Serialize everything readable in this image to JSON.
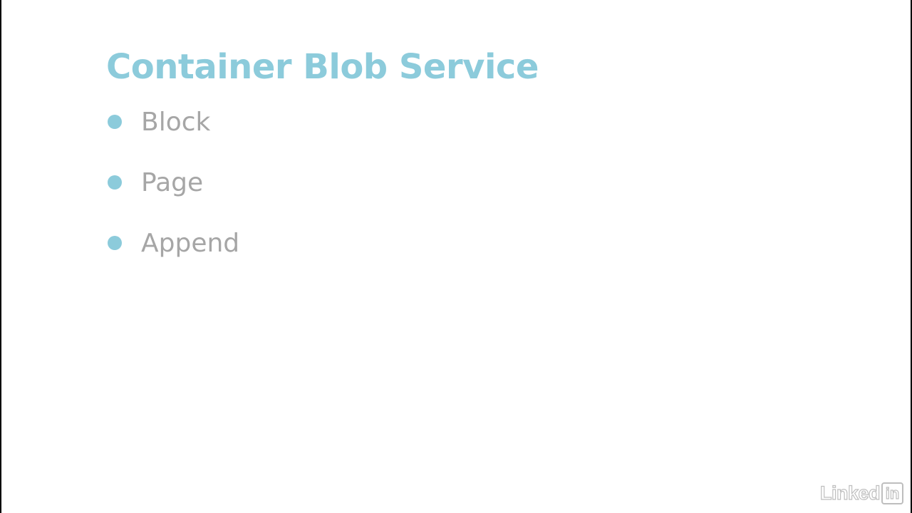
{
  "slide": {
    "title": "Container Blob Service",
    "bullets": [
      {
        "label": "Block"
      },
      {
        "label": "Page"
      },
      {
        "label": "Append"
      }
    ]
  },
  "branding": {
    "logo_text": "Linked",
    "logo_box_text": "in"
  },
  "colors": {
    "accent": "#8ccbdb",
    "bullet_text": "#a6a6a6",
    "background": "#ffffff",
    "frame": "#000000"
  }
}
